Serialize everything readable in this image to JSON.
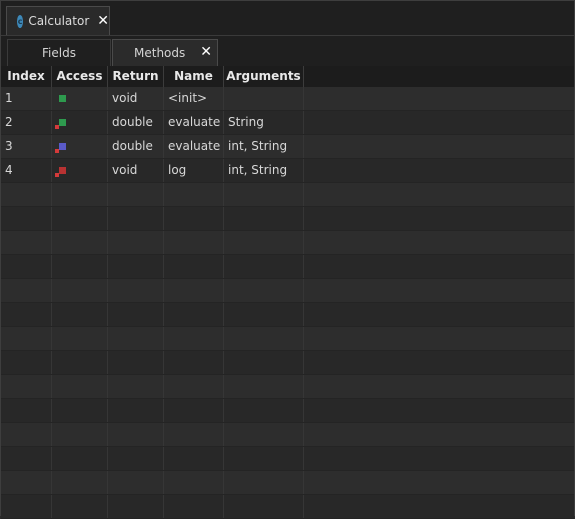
{
  "editor_tab": {
    "title": "Calculator",
    "icon": "class-icon",
    "icon_letter": "c",
    "close": "✕"
  },
  "subtabs": {
    "fields": "Fields",
    "methods": "Methods",
    "close": "✕"
  },
  "table": {
    "headers": [
      "Index",
      "Access",
      "Return",
      "Name",
      "Arguments"
    ],
    "rows": [
      {
        "index": "1",
        "access": "public",
        "access_color": "#2e9a4e",
        "modifier_color": "",
        "return": "void",
        "name": "<init>",
        "arguments": ""
      },
      {
        "index": "2",
        "access": "public-static",
        "access_color": "#2e9a4e",
        "modifier_color": "#d43a3a",
        "return": "double",
        "name": "evaluate",
        "arguments": "String"
      },
      {
        "index": "3",
        "access": "private-static",
        "access_color": "#5a5ac8",
        "modifier_color": "#d43a3a",
        "return": "double",
        "name": "evaluate",
        "arguments": "int, String"
      },
      {
        "index": "4",
        "access": "private-static",
        "access_color": "#b83232",
        "modifier_color": "#d43a3a",
        "return": "void",
        "name": "log",
        "arguments": "int, String"
      }
    ],
    "empty_row_count": 14
  }
}
